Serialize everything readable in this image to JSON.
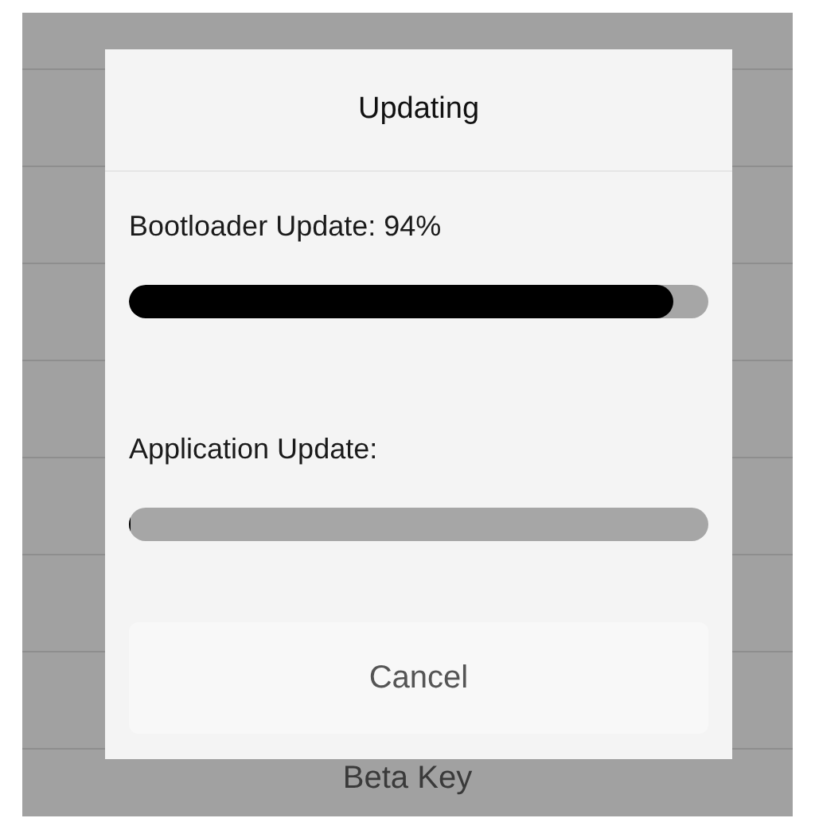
{
  "background": {
    "rows": [
      {
        "label": "Beta Key"
      }
    ]
  },
  "dialog": {
    "title": "Updating",
    "progress": [
      {
        "label": "Bootloader Update: 94%",
        "level": 0.94
      },
      {
        "label": "Application Update:",
        "level": 0
      }
    ],
    "button": "Cancel"
  }
}
